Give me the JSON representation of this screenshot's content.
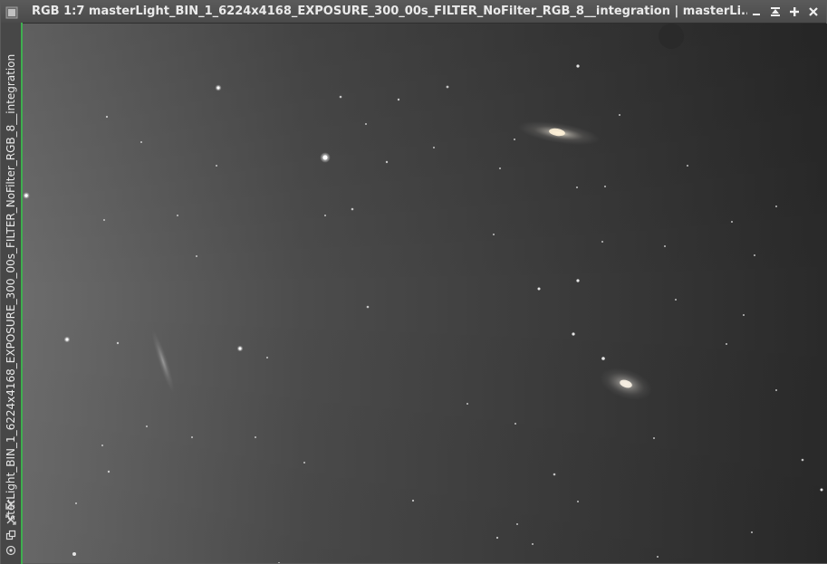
{
  "window": {
    "title": "RGB 1:7 masterLight_BIN_1_6224x4168_EXPOSURE_300_00s_FILTER_NoFilter_RGB_8__integration | masterLi..."
  },
  "title_buttons": [
    {
      "name": "minimize-button",
      "icon": "minimize-icon"
    },
    {
      "name": "shade-button",
      "icon": "shade-icon"
    },
    {
      "name": "maximize-button",
      "icon": "plus-icon"
    },
    {
      "name": "close-button",
      "icon": "close-icon"
    }
  ],
  "sidebar": {
    "tab_label": "sterLight_BIN_1_6224x4168_EXPOSURE_300_00s_FILTER_NoFilter_RGB_8__integration",
    "icons": [
      "zoom-fit-icon",
      "resize-icon",
      "clone-icon",
      "target-icon"
    ]
  },
  "image": {
    "description_colors": {
      "sky_left": "#707070",
      "sky_right": "#2c2c2c",
      "border_accent": "#3fae4f"
    }
  }
}
